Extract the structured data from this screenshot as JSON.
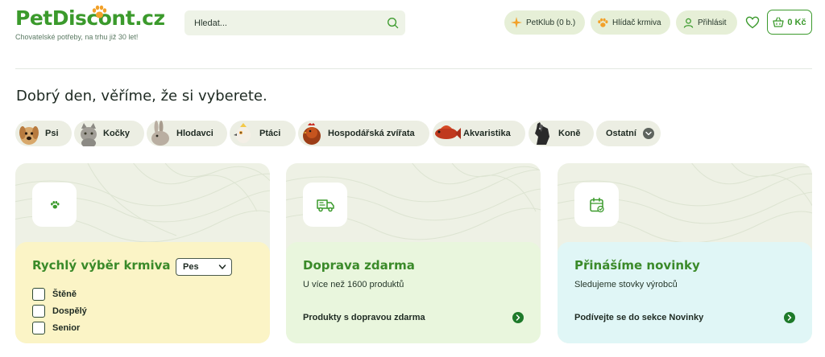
{
  "header": {
    "logo_text": "PetDiscont.cz",
    "tagline": "Chovatelské potřeby, na trhu již 30 let!",
    "search_placeholder": "Hledat...",
    "petklub_label": "PetKlub (0 b.)",
    "hlidac_label": "Hlídač krmiva",
    "login_label": "Přihlásit",
    "cart_label": "0 Kč"
  },
  "greeting": "Dobrý den, věříme, že si vyberete.",
  "categories": [
    {
      "label": "Psi",
      "icon": "dog-icon"
    },
    {
      "label": "Kočky",
      "icon": "cat-icon"
    },
    {
      "label": "Hlodavci",
      "icon": "rabbit-icon"
    },
    {
      "label": "Ptáci",
      "icon": "bird-icon"
    },
    {
      "label": "Hospodářská zvířata",
      "icon": "rooster-icon"
    },
    {
      "label": "Akvaristika",
      "icon": "fish-icon"
    },
    {
      "label": "Koně",
      "icon": "horse-icon"
    },
    {
      "label": "Ostatní",
      "icon": "chevron-down-icon"
    }
  ],
  "cards": {
    "quick": {
      "title": "Rychlý výběr krmiva",
      "select_value": "Pes",
      "options": [
        "Štěně",
        "Dospělý",
        "Senior"
      ],
      "icon": "paw-icon"
    },
    "shipping": {
      "title": "Doprava zdarma",
      "subtitle": "U více než 1600 produktů",
      "link": "Produkty s dopravou zdarma",
      "icon": "truck-icon"
    },
    "news": {
      "title": "Přinášíme novinky",
      "subtitle": "Sledujeme stovky výrobců",
      "link": "Podívejte se do sekce Novinky",
      "icon": "calendar-icon"
    }
  },
  "colors": {
    "brand_green": "#3b9a2c",
    "card_yellow": "#fbf4c6",
    "card_green": "#e9f6dd",
    "card_cyan": "#e0f6f6"
  }
}
